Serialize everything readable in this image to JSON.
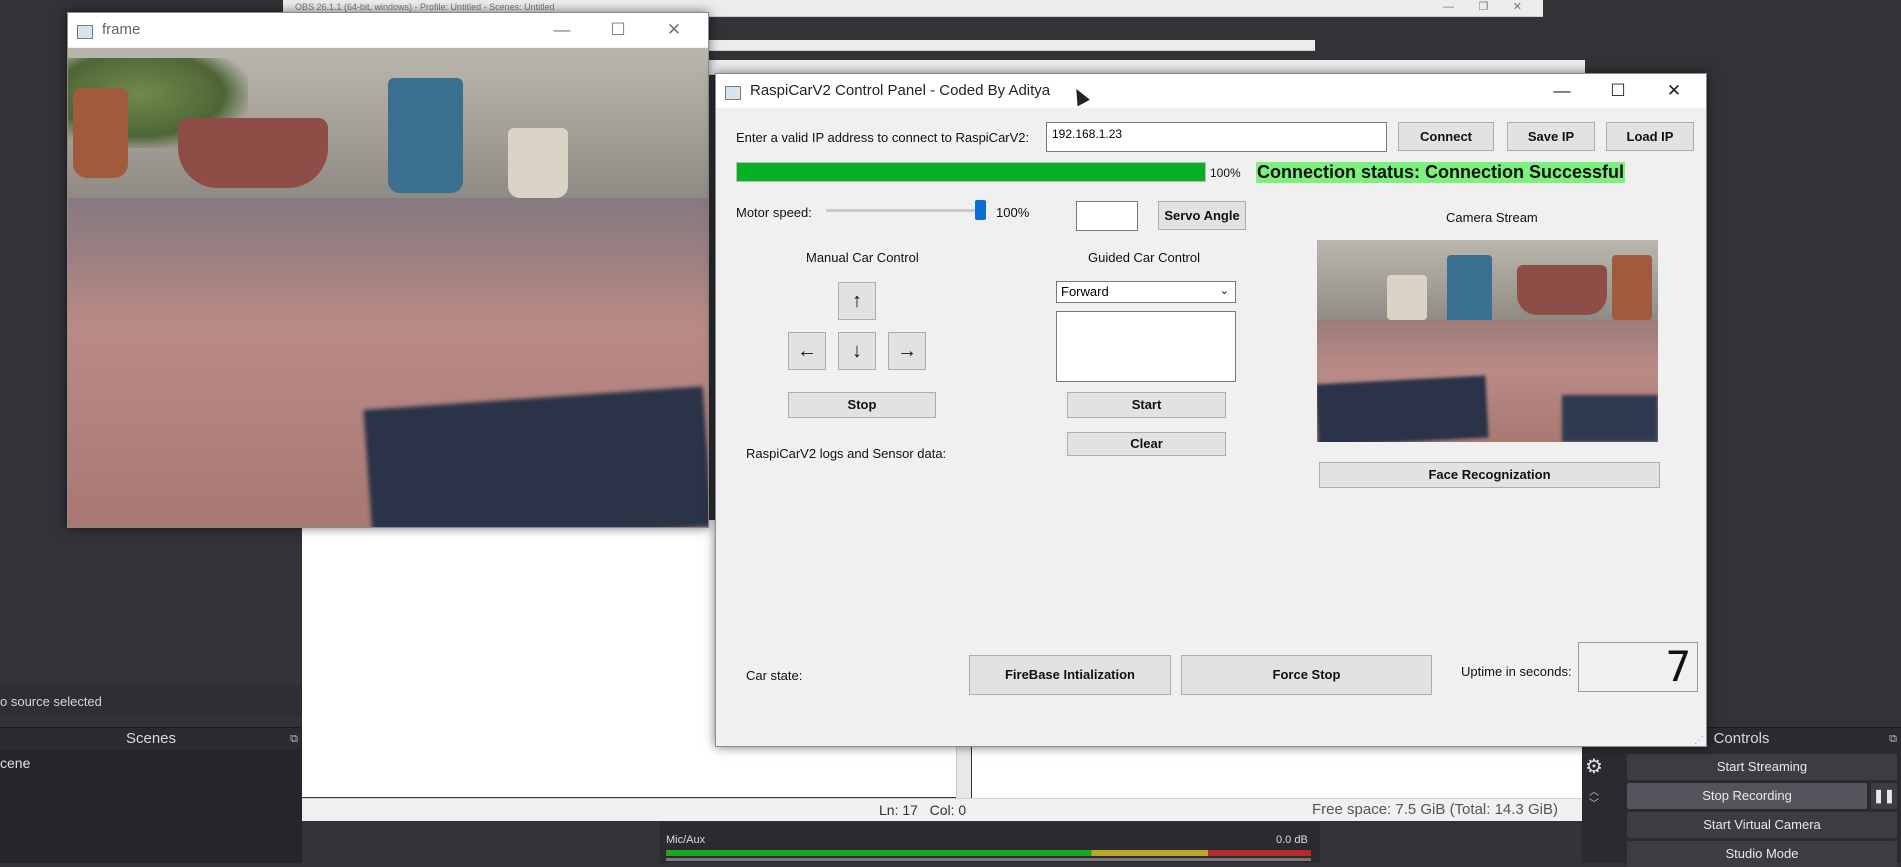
{
  "obs": {
    "window_title": "OBS 26.1.1 (64-bit, windows) - Profile: Untitled - Scenes: Untitled",
    "no_source_text": "o source selected",
    "scenes_title": "Scenes",
    "scene_item": "cene",
    "controls_title": "Controls",
    "buttons": {
      "start_streaming": "Start Streaming",
      "stop_recording": "Stop Recording",
      "start_virtual_camera": "Start Virtual Camera",
      "studio_mode": "Studio Mode"
    },
    "editor_status": "Ln: 17   Col: 0",
    "free_space": "Free space: 7.5 GiB (Total: 14.3 GiB)",
    "mixer_channel": "Mic/Aux",
    "mixer_db": "0.0 dB"
  },
  "frame_window": {
    "title": "frame"
  },
  "panel": {
    "title": "RaspiCarV2 Control Panel - Coded By Aditya",
    "ip_label": "Enter a valid IP address to connect to RaspiCarV2:",
    "ip_value": "192.168.1.23",
    "connect_label": "Connect",
    "save_ip_label": "Save IP",
    "load_ip_label": "Load IP",
    "progress_fraction": 1.0,
    "progress_text": "100%",
    "connection_status": "Connection status: Connection Successful",
    "motor_label": "Motor speed:",
    "motor_fraction": 1.0,
    "motor_value": "100%",
    "servo_value": "",
    "servo_label": "Servo Angle",
    "camera_label": "Camera Stream",
    "manual_label": "Manual Car Control",
    "guided_label": "Guided Car Control",
    "arrows": {
      "up": "↑",
      "left": "←",
      "down": "↓",
      "right": "→"
    },
    "stop_label": "Stop",
    "direction_selected": "Forward",
    "start_label": "Start",
    "clear_label": "Clear",
    "logs_label": "RaspiCarV2 logs and Sensor data:",
    "face_label": "Face Recognization",
    "car_state_label": "Car state:",
    "firebase_label": "FireBase Intialization",
    "force_stop_label": "Force Stop",
    "uptime_label": "Uptime in seconds:",
    "uptime_value": "7"
  },
  "colors": {
    "progress_green": "#06b025",
    "status_bg": "#7df07d",
    "slider_handle": "#0a6fd6"
  },
  "icons": [
    "window-icon",
    "minimize-icon",
    "maximize-icon",
    "close-icon",
    "chevron-down-icon",
    "gear-icon",
    "pause-icon",
    "cursor-icon"
  ]
}
